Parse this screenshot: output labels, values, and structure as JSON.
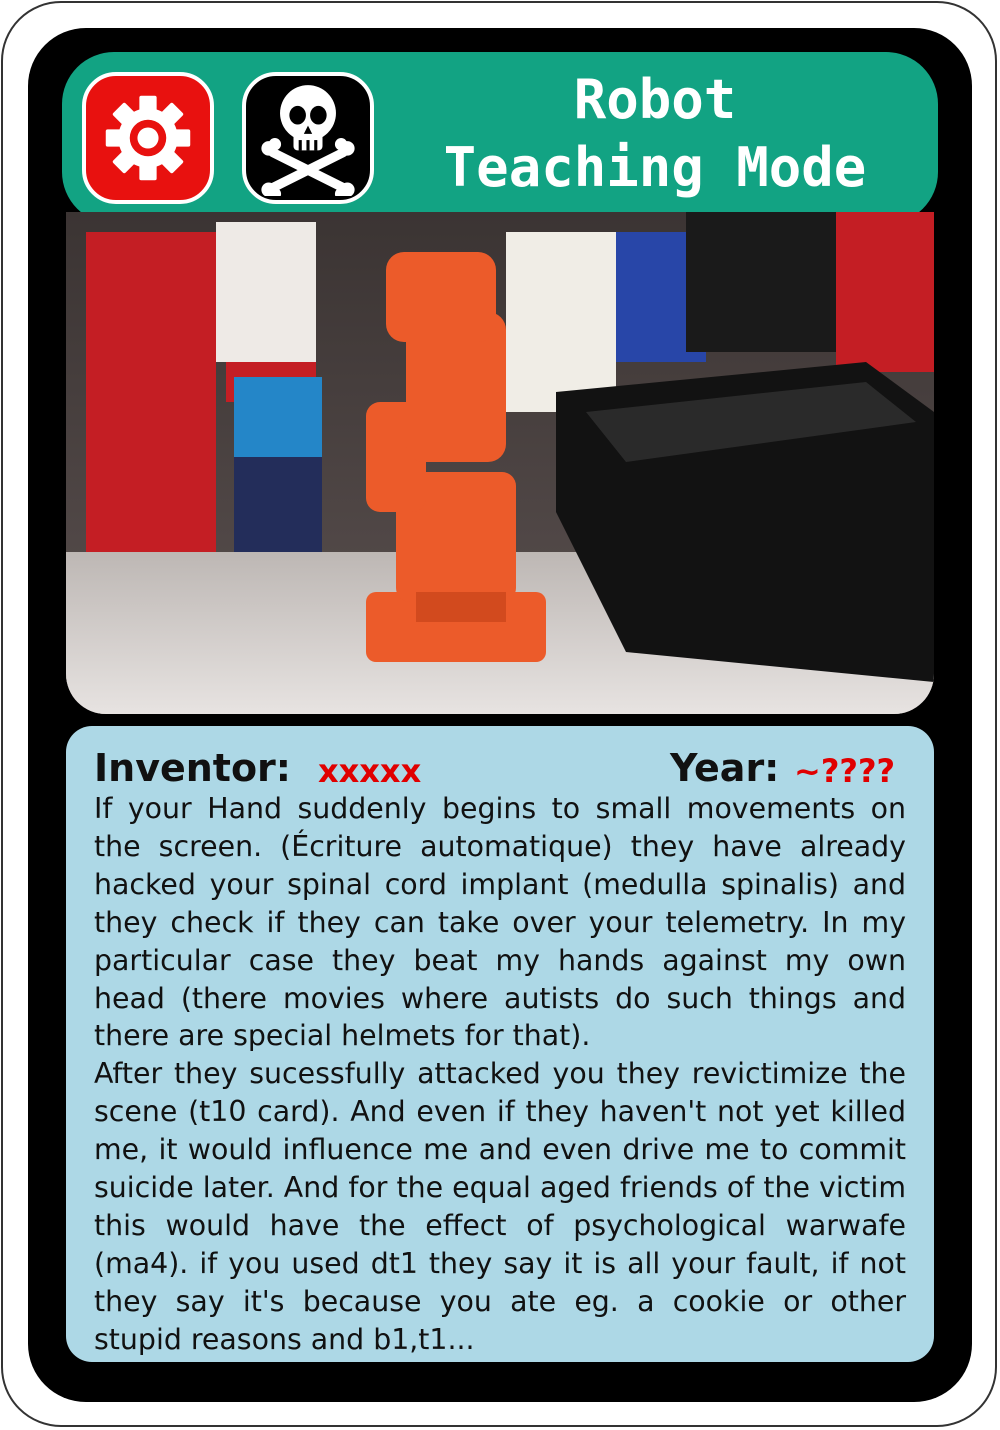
{
  "card": {
    "title_line1": "Robot",
    "title_line2": "Teaching Mode",
    "icons": [
      "gear-icon",
      "skull-crossbones-icon"
    ],
    "colors": {
      "header": "#12a383",
      "gear_badge": "#e8110f",
      "skull_badge": "#000000",
      "text_panel": "#add8e6",
      "highlight_red": "#e00000"
    },
    "inventor_label": "Inventor:",
    "inventor_value": "xxxxx",
    "year_label": "Year:",
    "year_value": "~????",
    "paragraph1": "If your Hand suddenly begins to small movements on the screen. (Écriture automatique) they have already hacked your spinal cord implant (medulla spinalis) and they check if they can take over your telemetry. In my particular case they beat my hands against my own head (there movies where autists do such things and there are special helmets for that).",
    "paragraph2": "After they sucessfully attacked you they revictimize the scene (t10 card). And even if they haven't not yet killed me, it would influence me and even drive me to commit suicide later. And for the equal aged friends of the victim this would have the effect of psychological warwafe (ma4). if you used dt1 they say it is all your fault, if not they say it's because you ate eg. a cookie or other stupid reasons and b1,t1..."
  }
}
